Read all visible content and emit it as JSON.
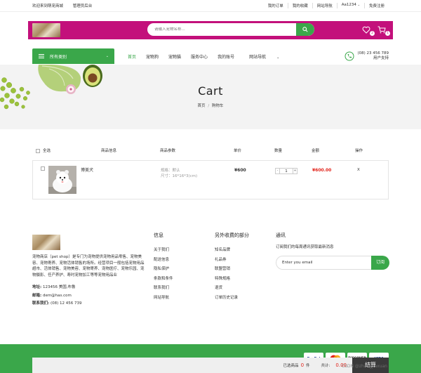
{
  "topbar": {
    "welcome": "欢迎来到萌宠商城",
    "admin": "管理员后台",
    "my_orders": "我的订单",
    "my_favorites": "我的收藏",
    "site_nav": "网站导航",
    "user": "Aa1234",
    "free_register": "免费注册"
  },
  "header": {
    "search_placeholder": "请输入宠物名称...",
    "wishlist_count": "2",
    "cart_count": "1",
    "brand_color": "#c3107b",
    "accent_color": "#3aa74a"
  },
  "nav": {
    "all_categories": "所有类别",
    "links": [
      "首页",
      "宠物狗",
      "宠物猫",
      "服务中心",
      "我的账号",
      "网站导航"
    ],
    "phone": "(08) 23 456 789",
    "phone_label": "用户支持"
  },
  "banner": {
    "title": "Cart",
    "breadcrumb_home": "首页",
    "breadcrumb_sep": "/",
    "breadcrumb_current": "购物车"
  },
  "cart": {
    "headers": {
      "select_all": "全选",
      "product_info": "商品信息",
      "product_params": "商品参数",
      "unit_price": "单价",
      "quantity": "数量",
      "amount": "金额",
      "action": "操作"
    },
    "items": [
      {
        "name": "博美犬",
        "spec_line1": "规格：默认",
        "spec_line2": "尺寸：16*16*3(cm)",
        "price": "¥600",
        "quantity": "1",
        "amount": "¥600.00",
        "remove": "X"
      }
    ]
  },
  "footer": {
    "about": "宠物商店（pet shop）是专门为宠物提供宠物用品零售、宠物美容、宠物寄养、宠物活体销售的场所。经营项目一般包括宠物用品超市、活体销售、宠物美容、宠物寄养、宠物医疗、宠物乐园、宠物摄影、任产养护、寿时宠物加工等等宠物用品业",
    "address_label": "地址:",
    "address": "123456 美国,布鲁",
    "email_label": "邮箱:",
    "email": "dem@has.com",
    "phone_label": "联系我们:",
    "phone": "(08) 12 456 739",
    "info_title": "信息",
    "info_links": [
      "关于我们",
      "配送信息",
      "隐私保护",
      "条款和条件",
      "联系我们",
      "网站导航"
    ],
    "extra_title": "另外收费的部分",
    "extra_links": [
      "知名品牌",
      "礼品券",
      "联盟营销",
      "特殊规格",
      "退货",
      "订单历史记录"
    ],
    "newsletter_title": "通讯",
    "newsletter_desc": "订阅我们的每周通讯获取最新消息",
    "newsletter_placeholder": "Enter you email",
    "subscribe": "订阅"
  },
  "bottom": {
    "payments": [
      "PayPal",
      "Mastercard",
      "DISCOVER",
      "VISA"
    ],
    "selected_label": "已选商品",
    "selected_count": "0",
    "selected_unit": "件",
    "total_label": "共计:",
    "total": "0.00",
    "settle": "结算",
    "watermark": "CSDN @zhangjiaxuan"
  }
}
